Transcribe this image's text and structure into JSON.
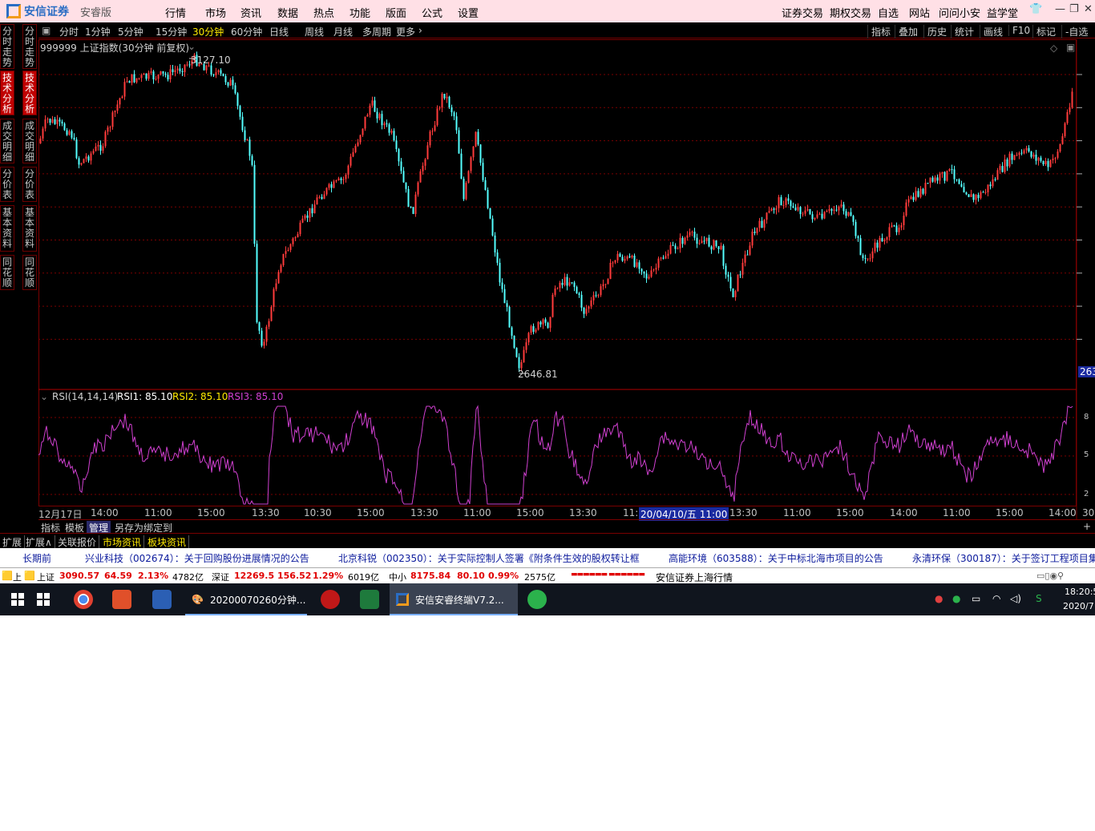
{
  "menubar": {
    "brand": "安信证券",
    "brand_sub": "安睿版",
    "items": [
      "行情",
      "市场",
      "资讯",
      "数据",
      "热点",
      "功能",
      "版面",
      "公式",
      "设置"
    ],
    "right_items": [
      "证券交易",
      "期权交易",
      "自选",
      "网站",
      "问问小安",
      "益学堂"
    ]
  },
  "left_tabs": {
    "col1": [
      "分时走势",
      "技术分析",
      "成交明细",
      "分价表",
      "基本资料",
      "同花顺"
    ],
    "col2": [
      "分时走势",
      "技术分析",
      "成交明细",
      "分价表",
      "基本资料",
      "同花顺"
    ],
    "active_index": 1
  },
  "toolbar": {
    "periods": [
      "分时",
      "1分钟",
      "5分钟",
      "15分钟",
      "30分钟",
      "60分钟",
      "日线",
      "周线",
      "月线",
      "多周期",
      "更多"
    ],
    "active_period": "30分钟",
    "right_items": [
      "指标",
      "叠加",
      "历史",
      "统计",
      "画线",
      "F10",
      "标记",
      "-自选"
    ]
  },
  "chart": {
    "title": "999999 上证指数(30分钟 前复权)",
    "high_label": "3127.10",
    "low_label": "2646.81",
    "price_tag": "263",
    "rsi": {
      "name": "RSI(14,14,14)",
      "rsi1": "RSI1: 85.10",
      "rsi2": "RSI2: 85.10",
      "rsi3": "RSI3: 85.10",
      "ticks": [
        "8",
        "5",
        "2"
      ]
    },
    "time_axis": [
      "12月17日",
      "14:00",
      "11:00",
      "15:00",
      "13:30",
      "10:30",
      "15:00",
      "13:30",
      "11:00",
      "15:00",
      "13:30",
      "11:",
      "20/04/10/五 11:00",
      "13:30",
      "11:00",
      "15:00",
      "14:00",
      "11:00",
      "15:00",
      "14:00",
      "30"
    ],
    "left_axis_stub": [
      "9",
      "20",
      "指"
    ],
    "chart_data": {
      "type": "candlestick",
      "note_high": 3127.1,
      "note_low": 2646.81
    }
  },
  "bottom_tabs": [
    "指标",
    "模板",
    "管理",
    "另存为",
    "绑定到"
  ],
  "bottom_active": "管理",
  "bottom_plus": "+",
  "info_tabs": [
    "扩展",
    "扩展∧",
    "关联报价",
    "市场资讯",
    "板块资讯"
  ],
  "ticker": [
    "长期前",
    "兴业科技（002674）：关于回购股份进展情况的公告",
    "北京科锐（002350）：关于实际控制人签署《附条件生效的股权转让框",
    "高能环境（603588）：关于中标北海市项目的公告",
    "永清环保（300187）：关于签订工程项目集"
  ],
  "status": {
    "sh_label": "上证",
    "sh_price": "3090.57",
    "sh_change": "64.59",
    "sh_pct": "2.13%",
    "sh_vol": "4782亿",
    "sz_label": "深证",
    "sz_price": "12269.5",
    "sz_change": "156.52",
    "sz_pct": "1.29%",
    "sz_vol": "6019亿",
    "zx_label": "中小",
    "zx_price": "8175.84",
    "zx_change": "80.10",
    "zx_pct": "0.99%",
    "zx_vol": "2575亿",
    "broker": "安信证券上海行情",
    "prefix": "上"
  },
  "taskbar": {
    "task1": "20200070260分钟...",
    "task2": "安信安睿终端V7.2...",
    "time": "18:20:5",
    "date": "2020/7"
  },
  "colors": {
    "up": "#ff3b3b",
    "down": "#54ffff",
    "rsi": "#d040d0",
    "grid": "#7a0000"
  }
}
